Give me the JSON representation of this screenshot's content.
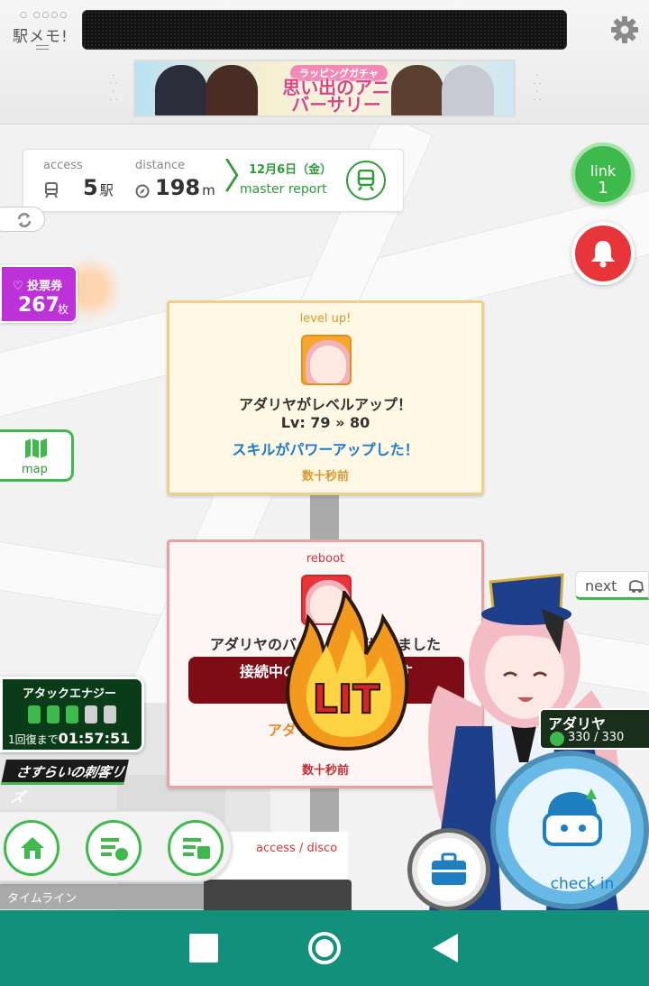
{
  "header": {
    "logo_text": "駅メモ!",
    "settings_icon": "gear-icon",
    "banner": {
      "tag": "ラッピングガチャ",
      "title": "思い出のアニバーサリー"
    }
  },
  "stats": {
    "access_label": "access",
    "access_value": "5",
    "access_unit": "駅",
    "distance_label": "distance",
    "distance_value": "198",
    "distance_unit": "m",
    "report_date": "12月6日（金）",
    "report_label": "master report"
  },
  "vote": {
    "label": "♡ 投票券",
    "count": "267",
    "unit": "枚"
  },
  "map_button": {
    "label": "map"
  },
  "link": {
    "label": "link",
    "count": "1"
  },
  "next_button": {
    "label": "next"
  },
  "level_up_card": {
    "tag": "level up!",
    "line1": "アダリヤがレベルアップ！",
    "line2": "Lv: 79 » 80",
    "line3": "スキルがパワーアップした！",
    "time": "数十秒前"
  },
  "reboot_card": {
    "tag": "reboot",
    "line1": "アダリヤのバッ　　　が切れました",
    "box_text": "接続中のリ　　　　　ます",
    "line3": "アダリー　　　…",
    "time": "数十秒前"
  },
  "lit_badge": "LIT",
  "energy": {
    "label": "アタックエナジー",
    "bars_filled": 3,
    "bars_total": 5,
    "timer_prefix": "1回復まで",
    "timer": "01:57:51"
  },
  "liz_label": "さすらいの刺客リズ",
  "character": {
    "name": "アダリヤ",
    "hp": "330 / 330"
  },
  "bottom_nav": {
    "timeline_label": "タイムライン",
    "access_discovery": "access / disco"
  },
  "checkin": {
    "label": "check in"
  },
  "colors": {
    "accent_green": "#3dba4b",
    "alert_red": "#e8353a",
    "vote_purple": "#bd31d8",
    "checkin_blue": "#69b9e6",
    "system_nav": "#12907c"
  }
}
